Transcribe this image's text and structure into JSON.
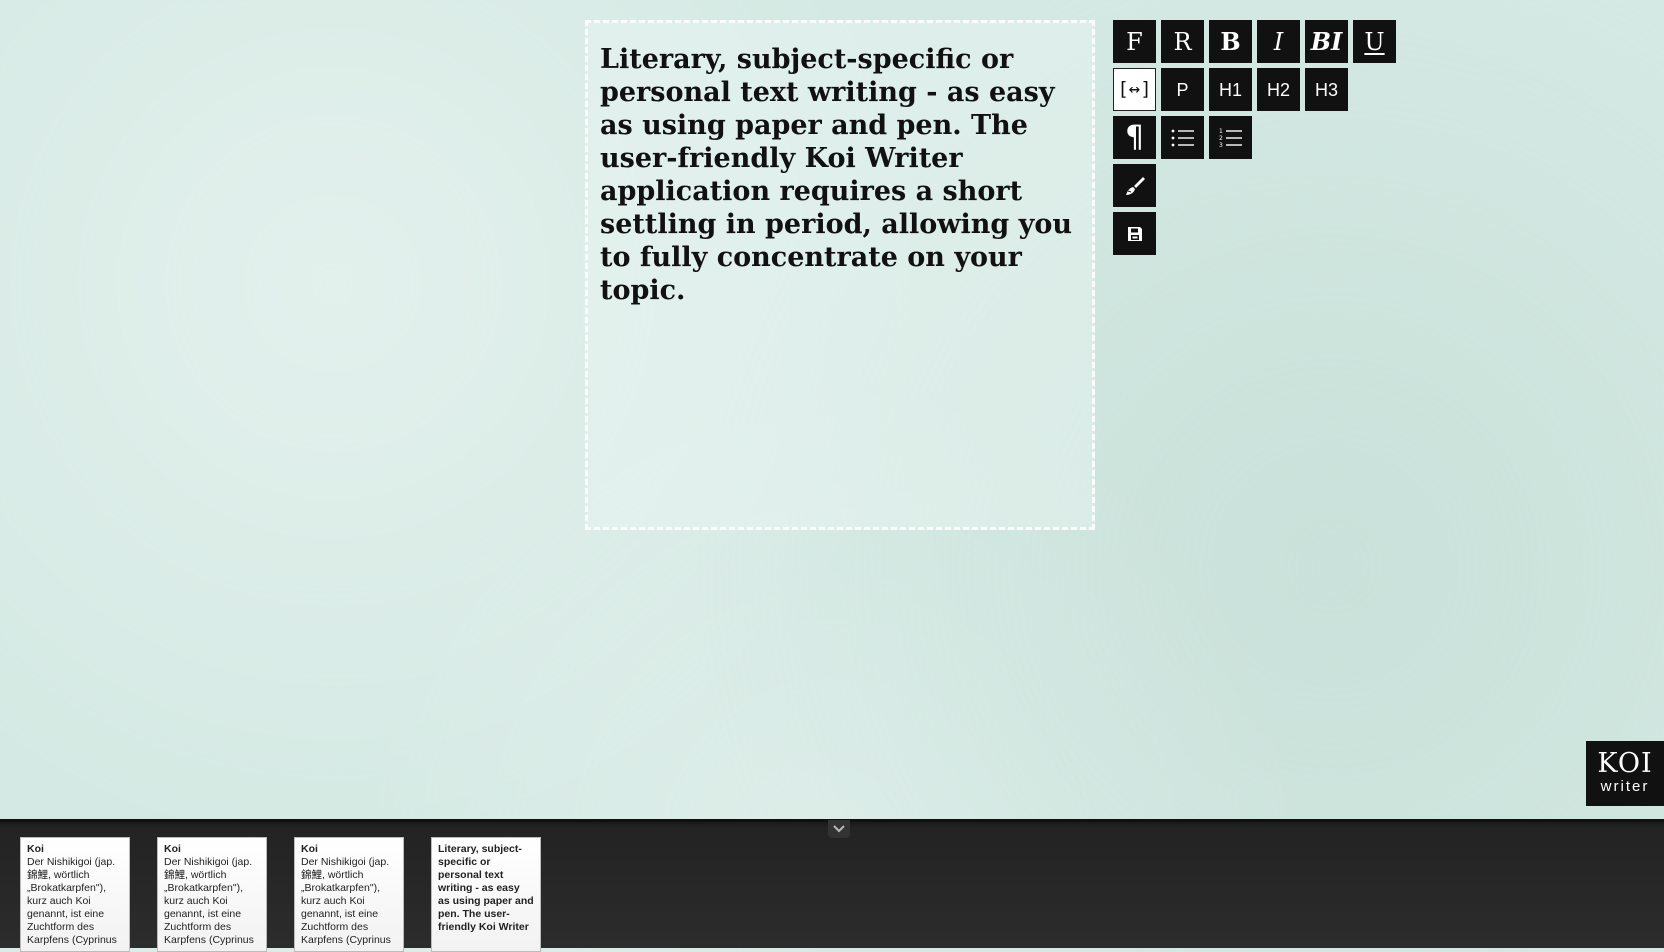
{
  "editor": {
    "text": "Literary, subject-specific or personal text writing - as easy as using paper and pen. The user-friendly Koi Writer application requires a short settling in period, allowing you to fully concentrate on your topic."
  },
  "toolbar": {
    "font_f": "F",
    "font_r": "R",
    "bold": "B",
    "italic": "I",
    "bold_italic": "BI",
    "underline": "U",
    "width_toggle": "[↔]",
    "paragraph": "P",
    "h1": "H1",
    "h2": "H2",
    "h3": "H3",
    "pilcrow": "¶",
    "icons": {
      "bullet_list": "bullet-list-icon",
      "numbered_list": "numbered-list-icon",
      "clear_format": "brush-icon",
      "save": "save-icon"
    }
  },
  "logo": {
    "title": "KOI",
    "subtitle": "writer"
  },
  "documents": [
    {
      "title": "Koi",
      "body": "Der Nishikigoi (jap. 錦鯉, wörtlich „Brokatkarpfen\"), kurz auch Koi genannt, ist eine Zuchtform des Karpfens (Cyprinus"
    },
    {
      "title": "Koi",
      "body": "Der Nishikigoi (jap. 錦鯉, wörtlich „Brokatkarpfen\"), kurz auch Koi genannt, ist eine Zuchtform des Karpfens (Cyprinus"
    },
    {
      "title": "Koi",
      "body": "Der Nishikigoi (jap. 錦鯉, wörtlich „Brokatkarpfen\"), kurz auch Koi genannt, ist eine Zuchtform des Karpfens (Cyprinus"
    },
    {
      "title": "",
      "body": "Literary, subject-specific or personal text writing - as easy as using paper and pen. The user-friendly Koi Writer"
    }
  ],
  "colors": {
    "background": "#d4e9e3",
    "toolbar_button": "#111111",
    "tray": "#2a2a2a"
  }
}
